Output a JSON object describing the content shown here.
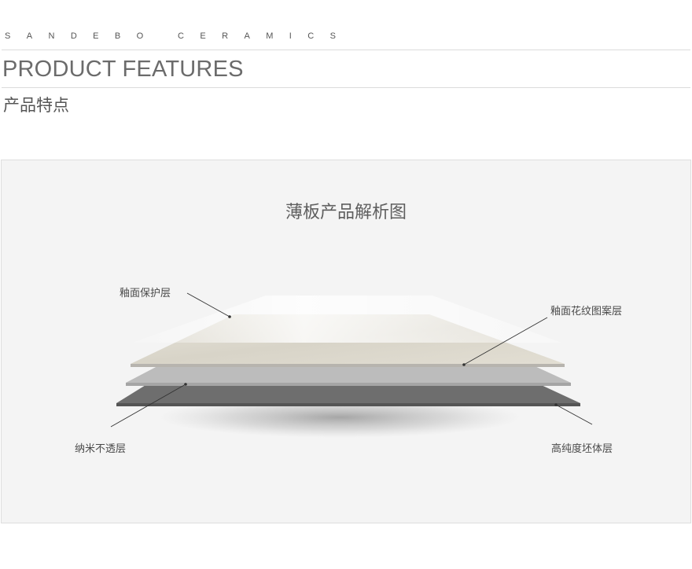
{
  "header": {
    "brand": "SANDEBO CERAMICS",
    "title_en": "PRODUCT FEATURES",
    "title_cn": "产品特点"
  },
  "diagram": {
    "title": "薄板产品解析图",
    "labels": {
      "glaze_protective": "釉面保护层",
      "glaze_pattern": "釉面花纹图案层",
      "nano_opaque": "纳米不透层",
      "high_purity_body": "高纯度坯体层"
    }
  },
  "colors": {
    "panel_bg": "#f4f4f4",
    "top_layer": "#dcd8cd",
    "middle_layer": "#b5b5b5",
    "bottom_layer": "#6e6e6e",
    "leader_lines": "#333333"
  }
}
